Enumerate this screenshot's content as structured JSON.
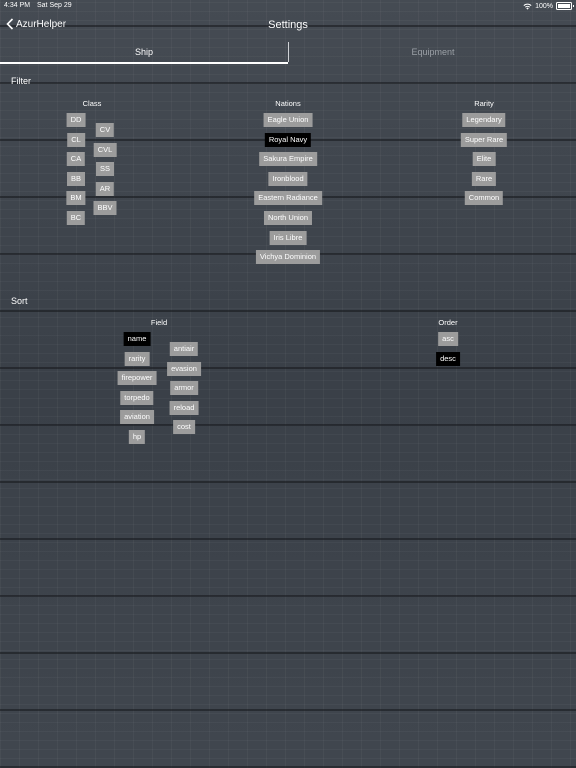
{
  "status": {
    "time": "4:34 PM",
    "date": "Sat Sep 29",
    "battery": "100%"
  },
  "nav": {
    "back_label": "AzurHelper",
    "title": "Settings"
  },
  "tabs": [
    {
      "label": "Ship"
    },
    {
      "label": "Equipment"
    }
  ],
  "filter": {
    "heading": "Filter",
    "class": {
      "title": "Class",
      "left": [
        "DD",
        "CL",
        "CA",
        "BB",
        "BM",
        "BC"
      ],
      "right": [
        "CV",
        "CVL",
        "SS",
        "AR",
        "BBV"
      ]
    },
    "nations": {
      "title": "Nations",
      "items": [
        "Eagle Union",
        "Royal Navy",
        "Sakura Empire",
        "Ironblood",
        "Eastern Radiance",
        "North Union",
        "Iris Libre",
        "Vichya Dominion"
      ],
      "selected": "Royal Navy"
    },
    "rarity": {
      "title": "Rarity",
      "items": [
        "Legendary",
        "Super Rare",
        "Elite",
        "Rare",
        "Common"
      ]
    }
  },
  "sort": {
    "heading": "Sort",
    "field": {
      "title": "Field",
      "left": [
        "name",
        "rarity",
        "firepower",
        "torpedo",
        "aviation",
        "hp"
      ],
      "right": [
        "antiair",
        "evasion",
        "armor",
        "reload",
        "cost"
      ],
      "selected": "name"
    },
    "order": {
      "title": "Order",
      "items": [
        "asc",
        "desc"
      ],
      "selected": "desc"
    }
  },
  "colors": {
    "chip": "#9c9c9c",
    "chip_selected": "#000000",
    "background": "#3b4149"
  }
}
